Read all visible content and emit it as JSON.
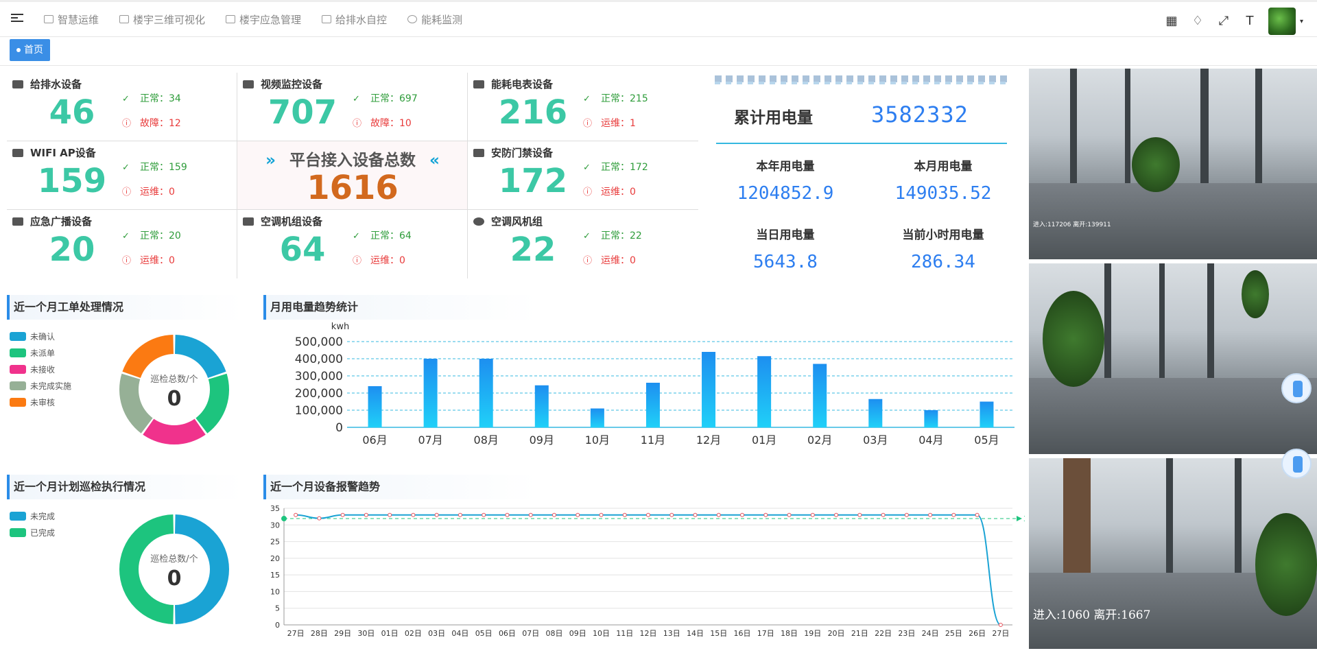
{
  "nav": {
    "items": [
      "智慧运维",
      "楼宇三维可视化",
      "楼宇应急管理",
      "给排水自控",
      "能耗监测"
    ]
  },
  "tags": {
    "home": "首页"
  },
  "stats": {
    "cells": [
      {
        "label": "给排水设备",
        "total": "46",
        "ok": "正常：34",
        "bad": "故障：12"
      },
      {
        "label": "视频监控设备",
        "total": "707",
        "ok": "正常：697",
        "bad": "故障：10"
      },
      {
        "label": "能耗电表设备",
        "total": "216",
        "ok": "正常：215",
        "bad": "运维：1"
      },
      {
        "label": "WIFI AP设备",
        "total": "159",
        "ok": "正常：159",
        "bad": "运维：0"
      },
      {
        "label": "安防门禁设备",
        "total": "172",
        "ok": "正常：172",
        "bad": "运维：0"
      },
      {
        "label": "应急广播设备",
        "total": "20",
        "ok": "正常：20",
        "bad": "运维：0"
      },
      {
        "label": "空调机组设备",
        "total": "64",
        "ok": "正常：64",
        "bad": "运维：0"
      },
      {
        "label": "空调风机组",
        "total": "22",
        "ok": "正常：22",
        "bad": "运维：0"
      }
    ],
    "center": {
      "title": "平台接入设备总数",
      "total": "1616",
      "arrow_left": "»",
      "arrow_right": "«"
    }
  },
  "electric": {
    "total_label": "累计用电量",
    "total_value": "3582332",
    "year_label": "本年用电量",
    "year_value": "1204852.9",
    "month_label": "本月用电量",
    "month_value": "149035.52",
    "day_label": "当日用电量",
    "day_value": "5643.8",
    "hour_label": "当前小时用电量",
    "hour_value": "286.34"
  },
  "workorder": {
    "title": "近一个月工单处理情况",
    "legend": [
      {
        "name": "未确认",
        "color": "#1aa3d4"
      },
      {
        "name": "未派单",
        "color": "#1dc47e"
      },
      {
        "name": "未接收",
        "color": "#f0328c"
      },
      {
        "name": "未完成实施",
        "color": "#96b096"
      },
      {
        "name": "未审核",
        "color": "#fb7a12"
      }
    ],
    "donut_label": "巡检总数/个",
    "donut_value": "0"
  },
  "inspection": {
    "title": "近一个月计划巡检执行情况",
    "legend": [
      {
        "name": "未完成",
        "color": "#1aa3d4"
      },
      {
        "name": "已完成",
        "color": "#1dc47e"
      }
    ],
    "donut_label": "巡检总数/个",
    "donut_value": "0"
  },
  "chart_data": [
    {
      "type": "bar",
      "title": "月用电量趋势统计",
      "ylabel": "kwh",
      "categories": [
        "06月",
        "07月",
        "08月",
        "09月",
        "10月",
        "11月",
        "12月",
        "01月",
        "02月",
        "03月",
        "04月",
        "05月"
      ],
      "values": [
        240000,
        400000,
        400000,
        245000,
        110000,
        260000,
        440000,
        415000,
        370000,
        165000,
        100000,
        150000
      ],
      "ylim": [
        0,
        500000
      ],
      "yticks": [
        "0",
        "100,000",
        "200,000",
        "300,000",
        "400,000",
        "500,000"
      ],
      "grid": true
    },
    {
      "type": "line",
      "title": "近一个月设备报警趋势",
      "categories": [
        "27日",
        "28日",
        "29日",
        "30日",
        "01日",
        "02日",
        "03日",
        "04日",
        "05日",
        "06日",
        "07日",
        "08日",
        "09日",
        "10日",
        "11日",
        "12日",
        "13日",
        "14日",
        "15日",
        "16日",
        "17日",
        "18日",
        "19日",
        "20日",
        "21日",
        "22日",
        "23日",
        "24日",
        "25日",
        "26日",
        "27日"
      ],
      "values": [
        33,
        32,
        33,
        33,
        33,
        33,
        33,
        33,
        33,
        33,
        33,
        33,
        33,
        33,
        33,
        33,
        33,
        33,
        33,
        33,
        33,
        33,
        33,
        33,
        33,
        33,
        33,
        33,
        33,
        33,
        0
      ],
      "ylim": [
        0,
        35
      ],
      "yticks": [
        "0",
        "5",
        "10",
        "15",
        "20",
        "25",
        "30",
        "35"
      ],
      "avg_label": "32",
      "grid": true
    }
  ],
  "cams": {
    "cam1_overlay": "进入:117206 离开:139911",
    "cam3_overlay": "进入:1060  离开:1667"
  }
}
